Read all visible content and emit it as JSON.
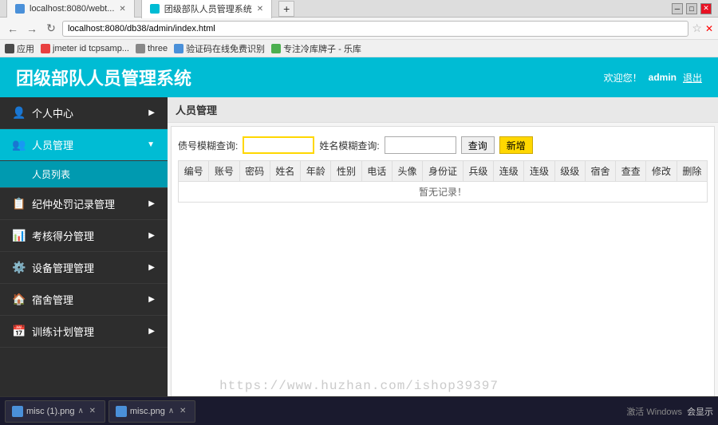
{
  "browser": {
    "title_bar": {
      "tab1_label": "localhost:8080/webt...",
      "tab2_label": "团级部队人员管理系统",
      "address": "localhost:8080/db38/admin/index.html",
      "bookmarks": [
        {
          "label": "应用"
        },
        {
          "label": "jmeter id tcpsamp..."
        },
        {
          "label": "three"
        },
        {
          "label": "验证码在线免费识别"
        },
        {
          "label": "专注冷库牌子 - 乐库"
        }
      ]
    }
  },
  "app": {
    "title": "团级部队人员管理系统",
    "header_welcome": "欢迎您！",
    "header_user": "admin",
    "header_logout": "退出",
    "sidebar": {
      "items": [
        {
          "label": "个人中心",
          "icon": "👤",
          "has_arrow": true,
          "active": false
        },
        {
          "label": "人员管理",
          "icon": "👥",
          "has_arrow": true,
          "active": true,
          "expanded": true
        },
        {
          "label": "人员列表",
          "is_sub": true,
          "active": true
        },
        {
          "label": "纪仲处罚记录管理",
          "icon": "📋",
          "has_arrow": true,
          "active": false
        },
        {
          "label": "考核得分管理",
          "icon": "📊",
          "has_arrow": true,
          "active": false
        },
        {
          "label": "设备管理管理",
          "icon": "⚙️",
          "has_arrow": true,
          "active": false
        },
        {
          "label": "宿舍管理",
          "icon": "🏠",
          "has_arrow": true,
          "active": false
        },
        {
          "label": "训练计划管理",
          "icon": "📅",
          "has_arrow": true,
          "active": false
        }
      ]
    },
    "main": {
      "breadcrumb": "人员管理",
      "search": {
        "label1": "债号模糊查询:",
        "input1_placeholder": "",
        "label2": "姓名模糊查询:",
        "input2_placeholder": "",
        "btn_query": "查询",
        "btn_add": "新增"
      },
      "table": {
        "columns": [
          "编号",
          "账号",
          "密码",
          "姓名",
          "年龄",
          "性别",
          "电话",
          "头像",
          "身份证",
          "兵级",
          "连级",
          "连级",
          "级级",
          "宿舍",
          "查查",
          "修改",
          "删除"
        ],
        "no_record": "暂无记录！"
      }
    }
  },
  "taskbar": {
    "items": [
      {
        "label": "misc (1).png"
      },
      {
        "label": "misc.png"
      }
    ],
    "right_text": "会显示",
    "activate_text": "激活 Windows"
  },
  "watermark": "https://www.huzhan.com/ishop39397",
  "status_bar_text": "团级部队人员管理系统"
}
